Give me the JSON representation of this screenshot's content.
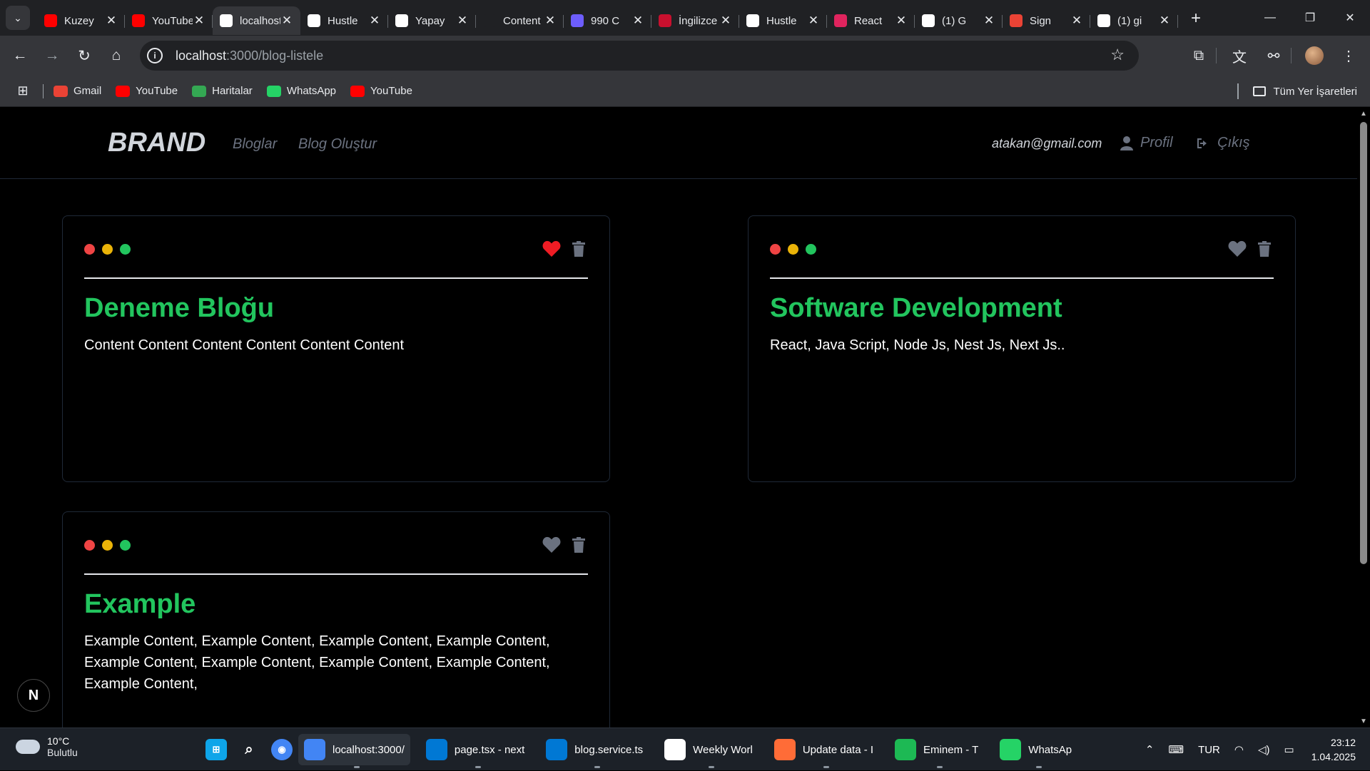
{
  "browser": {
    "tabs": [
      {
        "title": "Kuzey",
        "icon": "youtube-icon",
        "color": "#ff0000",
        "active": false
      },
      {
        "title": "YouTube",
        "icon": "youtube-icon",
        "color": "#ff0000",
        "active": false
      },
      {
        "title": "localhost",
        "icon": "nextjs-icon",
        "color": "#ffffff",
        "active": true
      },
      {
        "title": "Hustle",
        "icon": "hustle-icon",
        "color": "#ffffff",
        "active": false
      },
      {
        "title": "Yapay",
        "icon": "openai-icon",
        "color": "#ffffff",
        "active": false
      },
      {
        "title": "Content",
        "icon": "blank-icon",
        "color": "#202124",
        "active": false
      },
      {
        "title": "990 C",
        "icon": "ui-icon",
        "color": "#6d5dfc",
        "active": false
      },
      {
        "title": "İngilizce",
        "icon": "uk-flag-icon",
        "color": "#c8102e",
        "active": false
      },
      {
        "title": "Hustle",
        "icon": "hustle-icon",
        "color": "#ffffff",
        "active": false
      },
      {
        "title": "React",
        "icon": "react-icon",
        "color": "#e0245e",
        "active": false
      },
      {
        "title": "(1) G",
        "icon": "x-icon",
        "color": "#ffffff",
        "active": false
      },
      {
        "title": "Sign",
        "icon": "gmail-icon",
        "color": "#ea4335",
        "active": false
      },
      {
        "title": "(1) gi",
        "icon": "x-icon",
        "color": "#ffffff",
        "active": false
      }
    ],
    "url_host": "localhost",
    "url_rest": ":3000/blog-listele",
    "bookmarks": [
      {
        "label": "Gmail",
        "icon": "gmail-icon",
        "color": "#ea4335"
      },
      {
        "label": "YouTube",
        "icon": "youtube-icon",
        "color": "#ff0000"
      },
      {
        "label": "Haritalar",
        "icon": "maps-icon",
        "color": "#34a853"
      },
      {
        "label": "WhatsApp",
        "icon": "whatsapp-icon",
        "color": "#25d366"
      },
      {
        "label": "YouTube",
        "icon": "youtube-icon",
        "color": "#ff0000"
      }
    ],
    "bookmarks_all": "Tüm Yer İşaretleri"
  },
  "site": {
    "brand": "BRAND",
    "nav": {
      "blogs": "Bloglar",
      "create": "Blog Oluştur"
    },
    "user_email": "atakan@gmail.com",
    "profile": "Profil",
    "logout": "Çıkış",
    "accent": "#22c55e",
    "posts": [
      {
        "title": "Deneme Bloğu",
        "content": "Content Content Content Content Content Content",
        "liked": true
      },
      {
        "title": "Software Development",
        "content": "React, Java Script, Node Js, Nest Js, Next Js..",
        "liked": false
      },
      {
        "title": "Example",
        "content": "Example Content, Example Content, Example Content, Example Content, Example Content, Example Content, Example Content, Example Content, Example Content,",
        "liked": false
      }
    ],
    "next_badge": "N"
  },
  "taskbar": {
    "weather_temp": "10°C",
    "weather_desc": "Bulutlu",
    "apps": [
      {
        "label": "localhost:3000/",
        "icon": "chrome-icon",
        "color": "#4285f4",
        "active": true
      },
      {
        "label": "page.tsx - next",
        "icon": "vscode-icon",
        "color": "#0078d4",
        "active": false
      },
      {
        "label": "blog.service.ts",
        "icon": "vscode-icon",
        "color": "#0078d4",
        "active": false
      },
      {
        "label": "Weekly Worl",
        "icon": "notion-icon",
        "color": "#ffffff",
        "active": false
      },
      {
        "label": "Update data - I",
        "icon": "postman-icon",
        "color": "#ff6c37",
        "active": false
      },
      {
        "label": "Eminem - T",
        "icon": "spotify-icon",
        "color": "#1db954",
        "active": false
      },
      {
        "label": "WhatsAp",
        "icon": "whatsapp-icon",
        "color": "#25d366",
        "active": false
      }
    ],
    "lang": "TUR",
    "time": "23:12",
    "date": "1.04.2025"
  }
}
